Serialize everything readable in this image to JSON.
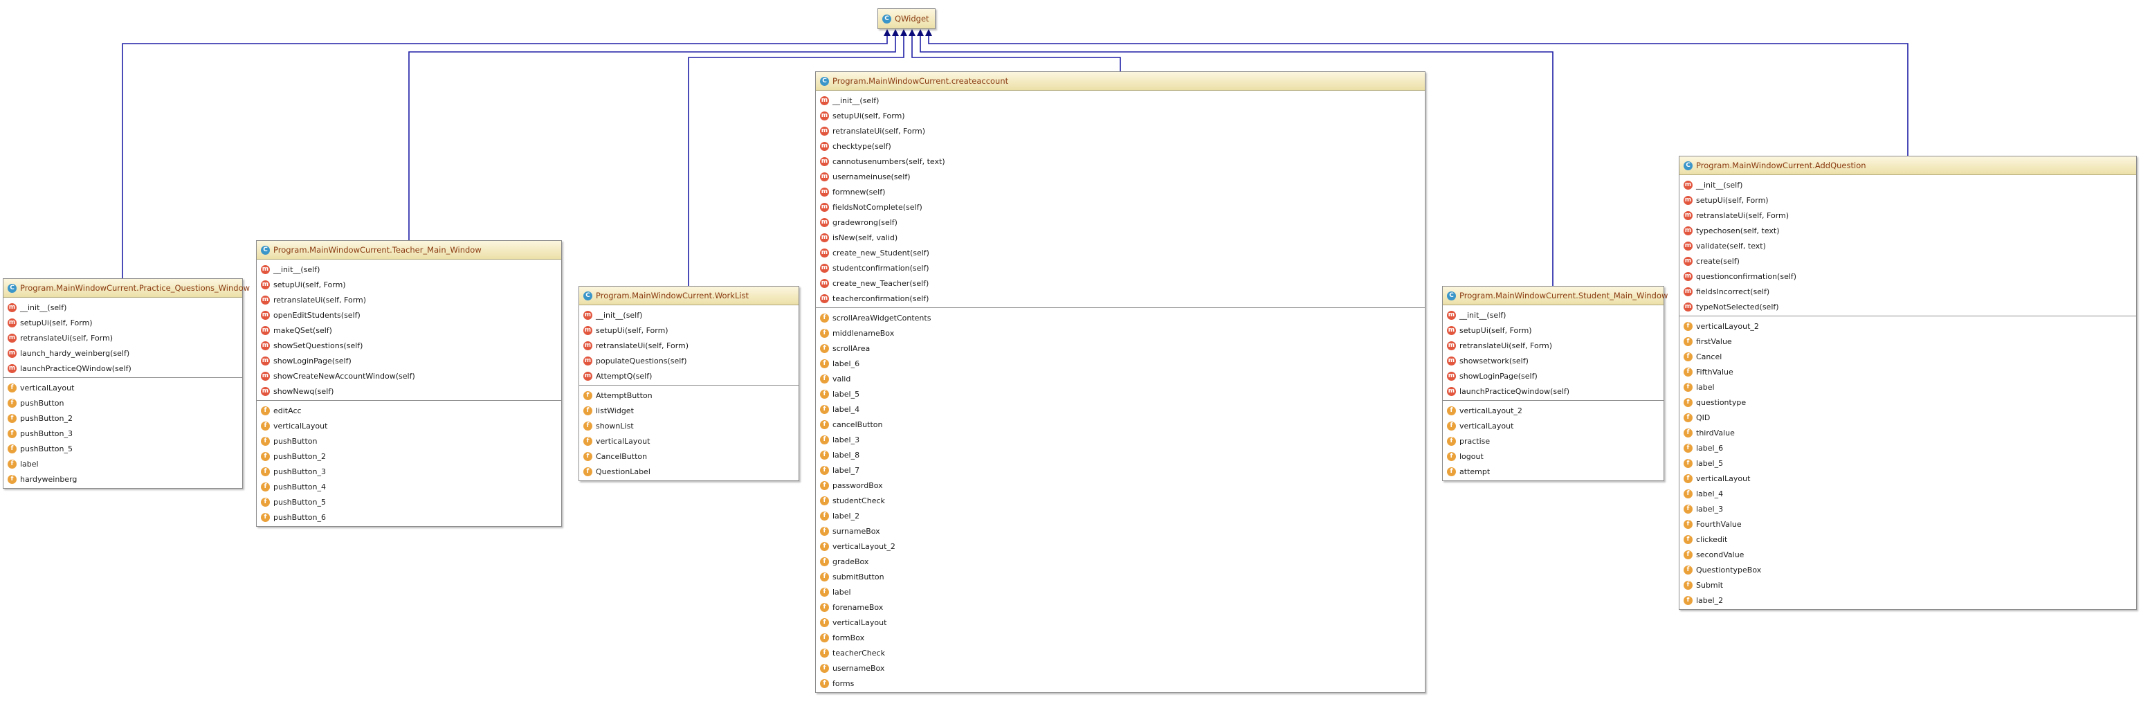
{
  "diagram": {
    "base": {
      "name": "QWidget",
      "kind": "C"
    },
    "classes": [
      {
        "id": "practice",
        "name": "Program.MainWindowCurrent.Practice_Questions_Window",
        "kind": "C",
        "methods": [
          "__init__(self)",
          "setupUi(self, Form)",
          "retranslateUi(self, Form)",
          "launch_hardy_weinberg(self)",
          "launchPracticeQWindow(self)"
        ],
        "fields": [
          "verticalLayout",
          "pushButton",
          "pushButton_2",
          "pushButton_3",
          "pushButton_5",
          "label",
          "hardyweinberg"
        ]
      },
      {
        "id": "teacher",
        "name": "Program.MainWindowCurrent.Teacher_Main_Window",
        "kind": "C",
        "methods": [
          "__init__(self)",
          "setupUi(self, Form)",
          "retranslateUi(self, Form)",
          "openEditStudents(self)",
          "makeQSet(self)",
          "showSetQuestions(self)",
          "showLoginPage(self)",
          "showCreateNewAccountWindow(self)",
          "showNewq(self)"
        ],
        "fields": [
          "editAcc",
          "verticalLayout",
          "pushButton",
          "pushButton_2",
          "pushButton_3",
          "pushButton_4",
          "pushButton_5",
          "pushButton_6"
        ]
      },
      {
        "id": "worklist",
        "name": "Program.MainWindowCurrent.WorkList",
        "kind": "C",
        "methods": [
          "__init__(self)",
          "setupUi(self, Form)",
          "retranslateUi(self, Form)",
          "populateQuestions(self)",
          "AttemptQ(self)"
        ],
        "fields": [
          "AttemptButton",
          "listWidget",
          "shownList",
          "verticalLayout",
          "CancelButton",
          "QuestionLabel"
        ]
      },
      {
        "id": "createaccount",
        "name": "Program.MainWindowCurrent.createaccount",
        "kind": "C",
        "methods": [
          "__init__(self)",
          "setupUi(self, Form)",
          "retranslateUi(self, Form)",
          "checktype(self)",
          "cannotusenumbers(self, text)",
          "usernameinuse(self)",
          "formnew(self)",
          "fieldsNotComplete(self)",
          "gradewrong(self)",
          "isNew(self, valid)",
          "create_new_Student(self)",
          "studentconfirmation(self)",
          "create_new_Teacher(self)",
          "teacherconfirmation(self)"
        ],
        "fields": [
          "scrollAreaWidgetContents",
          "middlenameBox",
          "scrollArea",
          "label_6",
          "valid",
          "label_5",
          "label_4",
          "cancelButton",
          "label_3",
          "label_8",
          "label_7",
          "passwordBox",
          "studentCheck",
          "label_2",
          "surnameBox",
          "verticalLayout_2",
          "gradeBox",
          "submitButton",
          "label",
          "forenameBox",
          "verticalLayout",
          "formBox",
          "teacherCheck",
          "usernameBox",
          "forms"
        ]
      },
      {
        "id": "student",
        "name": "Program.MainWindowCurrent.Student_Main_Window",
        "kind": "C",
        "methods": [
          "__init__(self)",
          "setupUi(self, Form)",
          "retranslateUi(self, Form)",
          "showsetwork(self)",
          "showLoginPage(self)",
          "launchPracticeQwindow(self)"
        ],
        "fields": [
          "verticalLayout_2",
          "verticalLayout",
          "practise",
          "logout",
          "attempt"
        ]
      },
      {
        "id": "addquestion",
        "name": "Program.MainWindowCurrent.AddQuestion",
        "kind": "C",
        "methods": [
          "__init__(self)",
          "setupUi(self, Form)",
          "retranslateUi(self, Form)",
          "typechosen(self, text)",
          "validate(self, text)",
          "create(self)",
          "questionconfirmation(self)",
          "fieldsIncorrect(self)",
          "typeNotSelected(self)"
        ],
        "fields": [
          "verticalLayout_2",
          "firstValue",
          "Cancel",
          "FifthValue",
          "label",
          "questiontype",
          "QID",
          "thirdValue",
          "label_6",
          "label_5",
          "verticalLayout",
          "label_4",
          "label_3",
          "FourthValue",
          "clickedit",
          "secondValue",
          "QuestiontypeBox",
          "Submit",
          "label_2"
        ]
      }
    ],
    "edge_color": "#1f1fa6",
    "arrow_color": "#0a0a7a"
  }
}
